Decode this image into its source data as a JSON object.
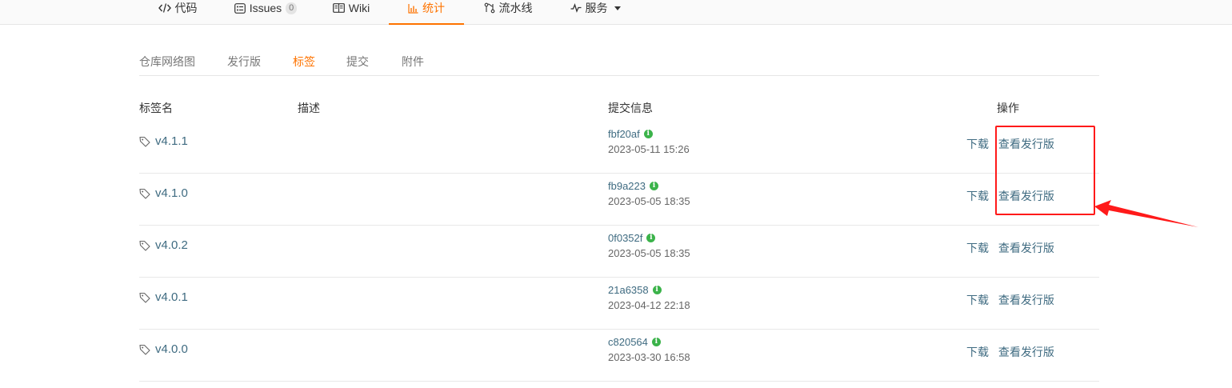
{
  "topnav": {
    "tabs": [
      {
        "key": "code",
        "label": "代码",
        "icon": "code-icon"
      },
      {
        "key": "issues",
        "label": "Issues",
        "icon": "issues-icon",
        "badge": "0"
      },
      {
        "key": "wiki",
        "label": "Wiki",
        "icon": "book-icon"
      },
      {
        "key": "stats",
        "label": "统计",
        "icon": "bar-chart-icon",
        "active": true
      },
      {
        "key": "pipeline",
        "label": "流水线",
        "icon": "pipeline-icon"
      },
      {
        "key": "services",
        "label": "服务",
        "icon": "pulse-icon",
        "dropdown": true
      }
    ]
  },
  "subnav": {
    "tabs": [
      {
        "label": "仓库网络图"
      },
      {
        "label": "发行版"
      },
      {
        "label": "标签",
        "active": true
      },
      {
        "label": "提交"
      },
      {
        "label": "附件"
      }
    ]
  },
  "table": {
    "headers": {
      "tag_name": "标签名",
      "description": "描述",
      "commit_info": "提交信息",
      "actions": "操作"
    },
    "rows": [
      {
        "tag": "v4.1.1",
        "sha": "fbf20af",
        "date": "2023-05-11 15:26",
        "download": "下载",
        "view_release": "查看发行版"
      },
      {
        "tag": "v4.1.0",
        "sha": "fb9a223",
        "date": "2023-05-05 18:35",
        "download": "下载",
        "view_release": "查看发行版"
      },
      {
        "tag": "v4.0.2",
        "sha": "0f0352f",
        "date": "2023-05-05 18:35",
        "download": "下载",
        "view_release": "查看发行版"
      },
      {
        "tag": "v4.0.1",
        "sha": "21a6358",
        "date": "2023-04-12 22:18",
        "download": "下载",
        "view_release": "查看发行版"
      },
      {
        "tag": "v4.0.0",
        "sha": "c820564",
        "date": "2023-03-30 16:58",
        "download": "下载",
        "view_release": "查看发行版"
      }
    ]
  },
  "colors": {
    "accent": "#fe7300",
    "link": "#3f6b81",
    "verified": "#3bb34a",
    "annotation": "#ff1a1a"
  }
}
